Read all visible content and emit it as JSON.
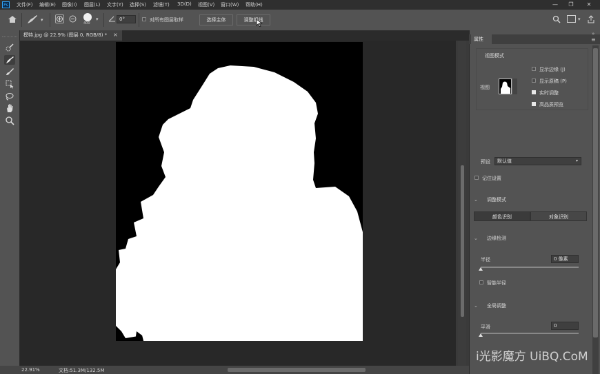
{
  "app": {
    "logo_text": "Ps"
  },
  "menu": [
    "文件(F)",
    "编辑(E)",
    "图像(I)",
    "图层(L)",
    "文字(Y)",
    "选择(S)",
    "滤镜(T)",
    "3D(D)",
    "视图(V)",
    "窗口(W)",
    "帮助(H)"
  ],
  "window_controls": {
    "minimize": "—",
    "restore": "❐",
    "close": "✕"
  },
  "options": {
    "brush_size": "400",
    "angle": "0°",
    "sample_all_layers": "对所有图层取样",
    "select_subject": "选择主体",
    "refine_hair": "调整细线"
  },
  "document_tab": {
    "title": "模特.jpg @ 22.9% (图层 0, RGB/8) *",
    "close": "×"
  },
  "status": {
    "zoom": "22.91%",
    "doc_info": "文档:51.3M/132.5M"
  },
  "panel": {
    "tab": "属性",
    "view_mode": {
      "title": "视图模式",
      "view_label": "视图",
      "show_edge": {
        "label": "显示边缘 (J)",
        "checked": false
      },
      "show_original": {
        "label": "显示原稿 (P)",
        "checked": false
      },
      "realtime": {
        "label": "实时调整",
        "checked": true
      },
      "hq_preview": {
        "label": "高品质预览",
        "checked": true
      }
    },
    "preset": {
      "label": "预设",
      "value": "默认值"
    },
    "remember": {
      "label": "记住设置",
      "checked": false
    },
    "refine_mode": {
      "title": "调整模式",
      "options": [
        "颜色识别",
        "对象识别"
      ],
      "selected": "颜色识别"
    },
    "edge_detection": {
      "title": "边缘检测",
      "radius_label": "半径",
      "radius_value": "0 像素",
      "radius_fraction": 0.0,
      "smart_radius": {
        "label": "智能半径",
        "checked": false
      }
    },
    "global": {
      "title": "全局调整",
      "smooth_label": "平滑",
      "smooth_value": "0",
      "smooth_fraction": 0.0
    }
  },
  "watermark": {
    "text": "i光影魔方 UiBQ.CoM"
  }
}
